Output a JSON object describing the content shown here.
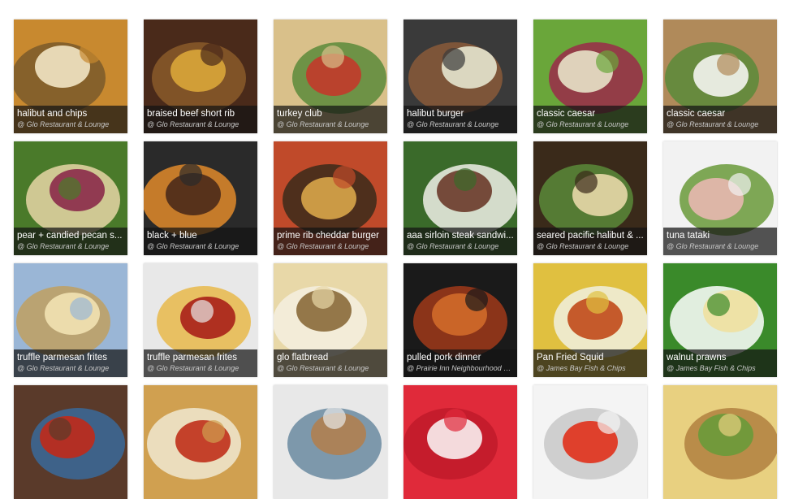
{
  "gallery": {
    "items": [
      {
        "title": "halibut and chips",
        "source": "@ Glo Restaurant & Lounge",
        "palette": [
          "#c8892f",
          "#f2e6c4",
          "#7a5a2a"
        ]
      },
      {
        "title": "braised beef short rib",
        "source": "@ Glo Restaurant & Lounge",
        "palette": [
          "#4a2a1a",
          "#d9a63a",
          "#8a5a2a"
        ]
      },
      {
        "title": "turkey club",
        "source": "@ Glo Restaurant & Lounge",
        "palette": [
          "#d9c08a",
          "#c23a2a",
          "#5a8a3a"
        ]
      },
      {
        "title": "halibut burger",
        "source": "@ Glo Restaurant & Lounge",
        "palette": [
          "#3a3a3a",
          "#e6e6cf",
          "#8a5a3a"
        ]
      },
      {
        "title": "classic caesar",
        "source": "@ Glo Restaurant & Lounge",
        "palette": [
          "#6aa63a",
          "#e8e2c8",
          "#9a2a4a"
        ]
      },
      {
        "title": "classic caesar",
        "source": "@ Glo Restaurant & Lounge",
        "palette": [
          "#b08a5a",
          "#f4f4f0",
          "#5a8a3a"
        ]
      },
      {
        "title": "pear + candied pecan s...",
        "source": "@ Glo Restaurant & Lounge",
        "palette": [
          "#4a7a2a",
          "#8a2a4a",
          "#e6d6a6"
        ]
      },
      {
        "title": "black + blue",
        "source": "@ Glo Restaurant & Lounge",
        "palette": [
          "#2a2a2a",
          "#4a2a1a",
          "#e08a2a"
        ]
      },
      {
        "title": "prime rib cheddar burger",
        "source": "@ Glo Restaurant & Lounge",
        "palette": [
          "#c04a2a",
          "#d9a64a",
          "#3a2a1a"
        ]
      },
      {
        "title": "aaa sirloin steak sandwi...",
        "source": "@ Glo Restaurant & Lounge",
        "palette": [
          "#3a6a2a",
          "#6a3a2a",
          "#f0f0e8"
        ]
      },
      {
        "title": "seared pacific halibut & ...",
        "source": "@ Glo Restaurant & Lounge",
        "palette": [
          "#3a2a1a",
          "#e8d8a8",
          "#5a8a3a"
        ]
      },
      {
        "title": "tuna tataki",
        "source": "@ Glo Restaurant & Lounge",
        "palette": [
          "#f2f2f2",
          "#e8b8b0",
          "#6a9a3a"
        ]
      },
      {
        "title": "truffle parmesan frites",
        "source": "@ Glo Restaurant & Lounge",
        "palette": [
          "#9ab6d6",
          "#f2e2b2",
          "#c0a060"
        ]
      },
      {
        "title": "truffle parmesan frites",
        "source": "@ Glo Restaurant & Lounge",
        "palette": [
          "#e8e8e8",
          "#a8201a",
          "#e8b84a"
        ]
      },
      {
        "title": "glo flatbread",
        "source": "@ Glo Restaurant & Lounge",
        "palette": [
          "#e8d8a8",
          "#8a6a3a",
          "#f4f0e0"
        ]
      },
      {
        "title": "pulled pork dinner",
        "source": "@ Prairie Inn Neighbourhood Pub",
        "palette": [
          "#1a1a1a",
          "#d06a2a",
          "#a03a1a"
        ]
      },
      {
        "title": "Pan Fried Squid",
        "source": "@ James Bay Fish & Chips",
        "palette": [
          "#e0c040",
          "#c04a1a",
          "#f0f0e0"
        ]
      },
      {
        "title": "walnut prawns",
        "source": "@ James Bay Fish & Chips",
        "palette": [
          "#3a8a2a",
          "#f0e0a0",
          "#ffffff"
        ]
      },
      {
        "title": "",
        "source": "",
        "palette": [
          "#5a3a2a",
          "#c02a1a",
          "#3a6a9a"
        ]
      },
      {
        "title": "",
        "source": "",
        "palette": [
          "#d0a050",
          "#c0301a",
          "#f0e8d0"
        ]
      },
      {
        "title": "",
        "source": "",
        "palette": [
          "#e8e8e8",
          "#b08050",
          "#6a8aa0"
        ]
      },
      {
        "title": "",
        "source": "",
        "palette": [
          "#e02a3a",
          "#f8f0f0",
          "#c01a2a"
        ]
      },
      {
        "title": "",
        "source": "",
        "palette": [
          "#f4f4f4",
          "#e0301a",
          "#c8c8c8"
        ]
      },
      {
        "title": "",
        "source": "",
        "palette": [
          "#e8d080",
          "#6a9a3a",
          "#b08040"
        ]
      }
    ]
  }
}
